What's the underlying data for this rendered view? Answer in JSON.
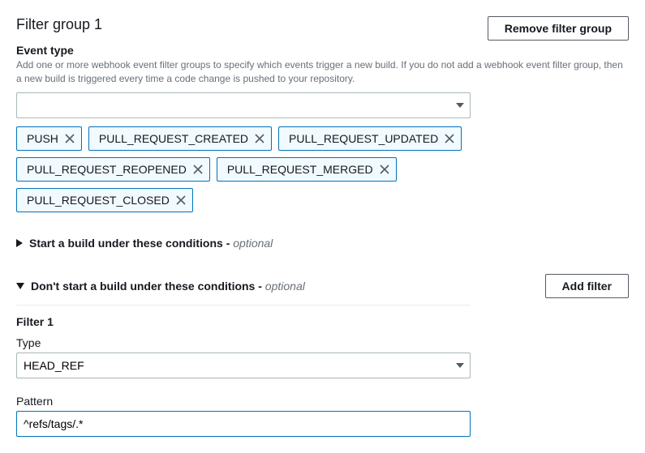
{
  "header": {
    "title": "Filter group 1",
    "remove_label": "Remove filter group"
  },
  "event_type": {
    "label": "Event type",
    "help": "Add one or more webhook event filter groups to specify which events trigger a new build. If you do not add a webhook event filter group, then a new build is triggered every time a code change is pushed to your repository.",
    "selected": ""
  },
  "tokens": [
    "PUSH",
    "PULL_REQUEST_CREATED",
    "PULL_REQUEST_UPDATED",
    "PULL_REQUEST_REOPENED",
    "PULL_REQUEST_MERGED",
    "PULL_REQUEST_CLOSED"
  ],
  "sections": {
    "start": {
      "title": "Start a build under these conditions -",
      "optional": "optional"
    },
    "dont_start": {
      "title": "Don't start a build under these conditions -",
      "optional": "optional"
    }
  },
  "add_filter_label": "Add filter",
  "filter1": {
    "heading": "Filter 1",
    "type_label": "Type",
    "type_value": "HEAD_REF",
    "pattern_label": "Pattern",
    "pattern_value": "^refs/tags/.*"
  }
}
